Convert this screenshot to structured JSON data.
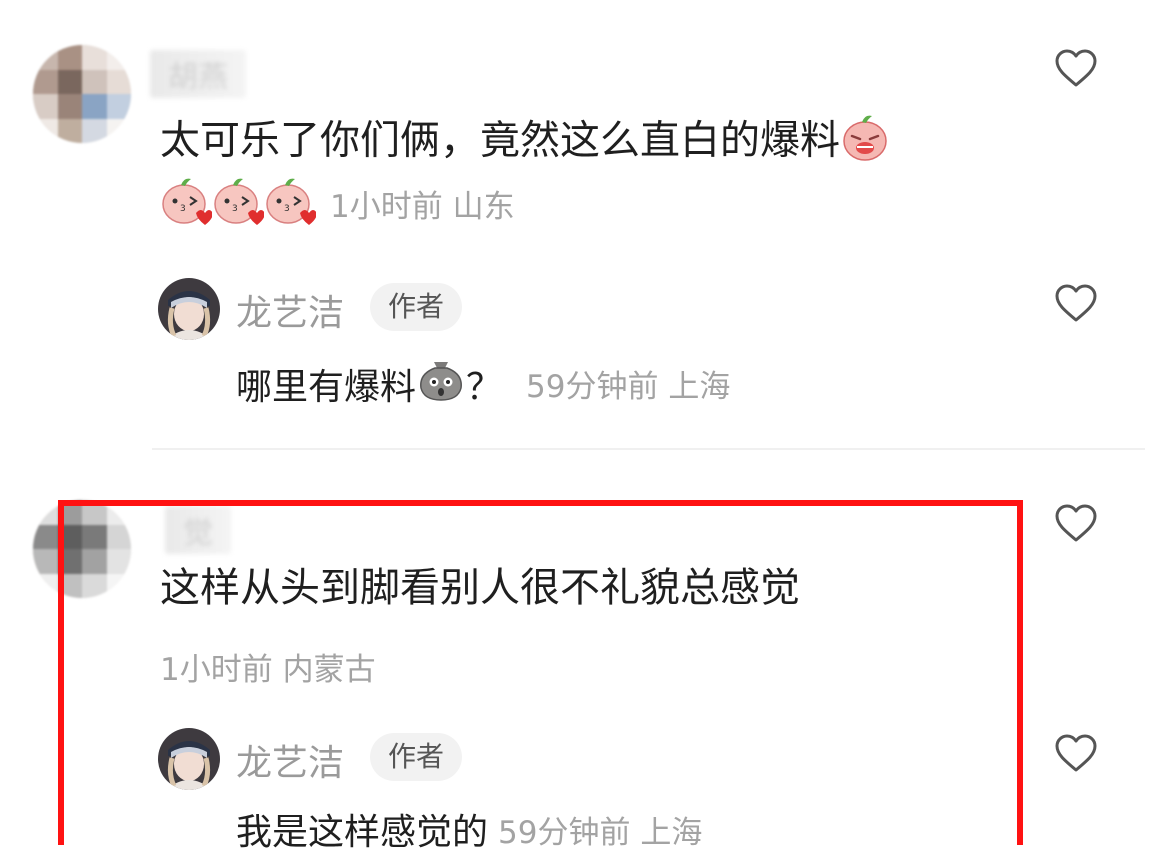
{
  "comments": [
    {
      "username_blurred": "胡燕",
      "text": "太可乐了你们俩，竟然这么直白的爆料",
      "meta": "1小时前 山东",
      "reply": {
        "author": "龙艺洁",
        "tag": "作者",
        "text": "哪里有爆料",
        "suffix": "？",
        "meta": "59分钟前 上海"
      }
    },
    {
      "username_blurred": "觉",
      "text": "这样从头到脚看别人很不礼貌总感觉",
      "meta": "1小时前 内蒙古",
      "reply": {
        "author": "龙艺洁",
        "tag": "作者",
        "text": "我是这样感觉的",
        "meta": "59分钟前 上海"
      }
    }
  ],
  "colors": {
    "highlight": "#ff1212",
    "meta": "#a3a3a3",
    "name": "#9a9a9a"
  },
  "icons": [
    "heart-outline-icon",
    "peach-crying-emoji",
    "peach-kiss-emoji",
    "sack-shocked-emoji"
  ]
}
